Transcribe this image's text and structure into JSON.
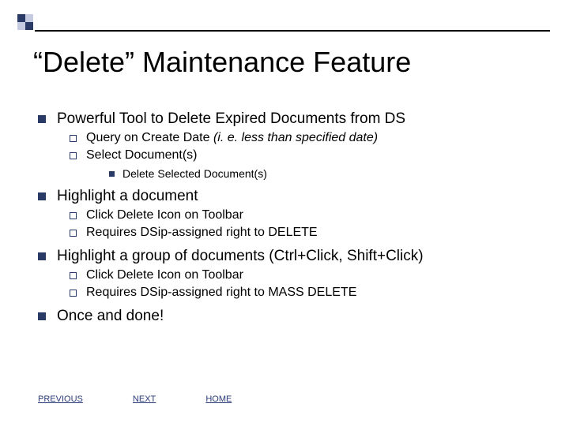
{
  "title": "“Delete” Maintenance Feature",
  "bullets": {
    "b1": "Powerful Tool to Delete Expired Documents from DS",
    "b1_1_a": "Query on Create Date ",
    "b1_1_b": "(i. e. less than specified date)",
    "b1_2": "Select Document(s)",
    "b1_2_1": "Delete Selected Document(s)",
    "b2": "Highlight a document",
    "b2_1": "Click Delete Icon on Toolbar",
    "b2_2": "Requires DSip-assigned right to DELETE",
    "b3": "Highlight a group of documents (Ctrl+Click, Shift+Click)",
    "b3_1": "Click Delete Icon on Toolbar",
    "b3_2": "Requires DSip-assigned right to MASS DELETE",
    "b4": "Once and done!"
  },
  "nav": {
    "previous": "PREVIOUS",
    "next": "NEXT",
    "home": "HOME"
  }
}
